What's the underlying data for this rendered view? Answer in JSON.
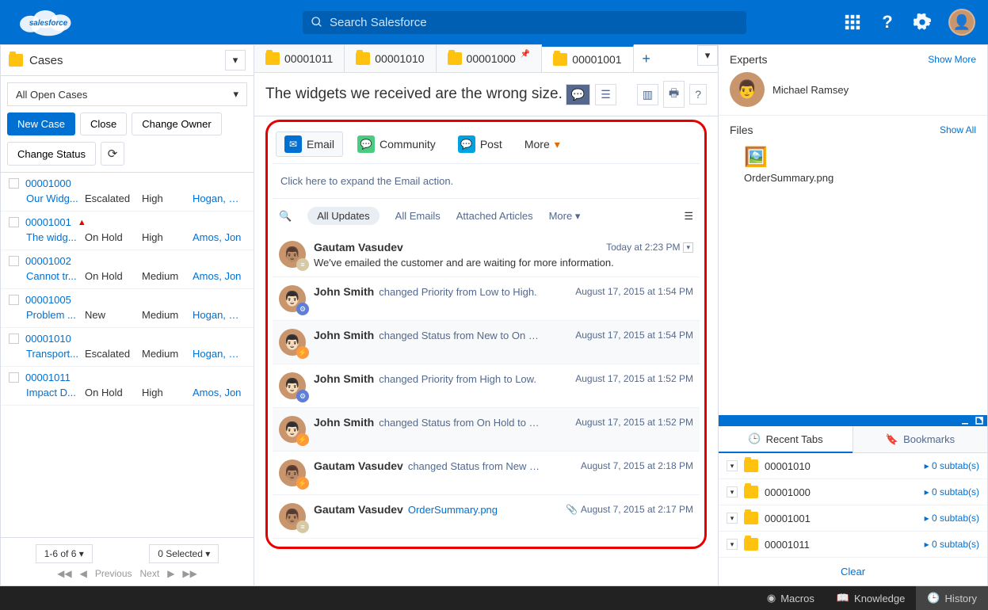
{
  "search": {
    "placeholder": "Search Salesforce"
  },
  "left": {
    "title": "Cases",
    "filter": "All Open Cases",
    "buttons": {
      "new": "New Case",
      "close": "Close",
      "change_owner": "Change Owner",
      "change_status": "Change Status"
    },
    "cases": [
      {
        "num": "00001000",
        "subj": "Our Widg...",
        "status": "Escalated",
        "priority": "High",
        "owner": "Hogan, M...",
        "flag": false
      },
      {
        "num": "00001001",
        "subj": "The widg...",
        "status": "On Hold",
        "priority": "High",
        "owner": "Amos, Jon",
        "flag": true
      },
      {
        "num": "00001002",
        "subj": "Cannot tr...",
        "status": "On Hold",
        "priority": "Medium",
        "owner": "Amos, Jon",
        "flag": false
      },
      {
        "num": "00001005",
        "subj": "Problem ...",
        "status": "New",
        "priority": "Medium",
        "owner": "Hogan, M...",
        "flag": false
      },
      {
        "num": "00001010",
        "subj": "Transport...",
        "status": "Escalated",
        "priority": "Medium",
        "owner": "Hogan, M...",
        "flag": false
      },
      {
        "num": "00001011",
        "subj": "Impact D...",
        "status": "On Hold",
        "priority": "High",
        "owner": "Amos, Jon",
        "flag": false
      }
    ],
    "pager": {
      "range": "1-6 of 6",
      "selected": "0 Selected",
      "prev": "Previous",
      "next": "Next"
    }
  },
  "tabs": [
    {
      "label": "00001011"
    },
    {
      "label": "00001010"
    },
    {
      "label": "00001000",
      "pinned": true
    },
    {
      "label": "00001001",
      "active": true
    }
  ],
  "case": {
    "title": "The widgets we received are the wrong size.",
    "publisher": {
      "email": "Email",
      "community": "Community",
      "post": "Post",
      "more": "More",
      "hint": "Click here to expand the Email action."
    },
    "filters": {
      "all": "All Updates",
      "emails": "All Emails",
      "articles": "Attached Articles",
      "more": "More"
    },
    "feed": [
      {
        "name": "Gautam Vasudev",
        "action": "",
        "text": "We've emailed the customer and are waiting for more information.",
        "time": "Today at 2:23 PM",
        "badge": "note",
        "av": 1,
        "caret": true
      },
      {
        "name": "John Smith",
        "action": "changed Priority from Low to High.",
        "time": "August 17, 2015 at 1:54 PM",
        "badge": "gear",
        "av": 2
      },
      {
        "name": "John Smith",
        "action": "changed Status from New to On …",
        "time": "August 17, 2015 at 1:54 PM",
        "badge": "bolt",
        "av": 2,
        "alt": true
      },
      {
        "name": "John Smith",
        "action": "changed Priority from High to Low.",
        "time": "August 17, 2015 at 1:52 PM",
        "badge": "gear",
        "av": 2
      },
      {
        "name": "John Smith",
        "action": "changed Status from On Hold to …",
        "time": "August 17, 2015 at 1:52 PM",
        "badge": "bolt",
        "av": 2,
        "alt": true
      },
      {
        "name": "Gautam Vasudev",
        "action": "changed Status from New …",
        "time": "August 7, 2015 at 2:18 PM",
        "badge": "bolt",
        "av": 1
      },
      {
        "name": "Gautam Vasudev",
        "action": "",
        "link": "OrderSummary.png",
        "time": "August 7, 2015 at 2:17 PM",
        "badge": "note",
        "av": 1,
        "clip": true
      }
    ]
  },
  "right": {
    "experts": {
      "title": "Experts",
      "more": "Show More",
      "name": "Michael Ramsey"
    },
    "files": {
      "title": "Files",
      "more": "Show All",
      "name": "OrderSummary.png"
    },
    "hist_tabs": {
      "recent": "Recent Tabs",
      "bookmarks": "Bookmarks"
    },
    "recent": [
      {
        "num": "00001010",
        "sub": "0 subtab(s)"
      },
      {
        "num": "00001000",
        "sub": "0 subtab(s)"
      },
      {
        "num": "00001001",
        "sub": "0 subtab(s)"
      },
      {
        "num": "00001011",
        "sub": "0 subtab(s)"
      }
    ],
    "clear": "Clear"
  },
  "footer": {
    "macros": "Macros",
    "knowledge": "Knowledge",
    "history": "History"
  }
}
